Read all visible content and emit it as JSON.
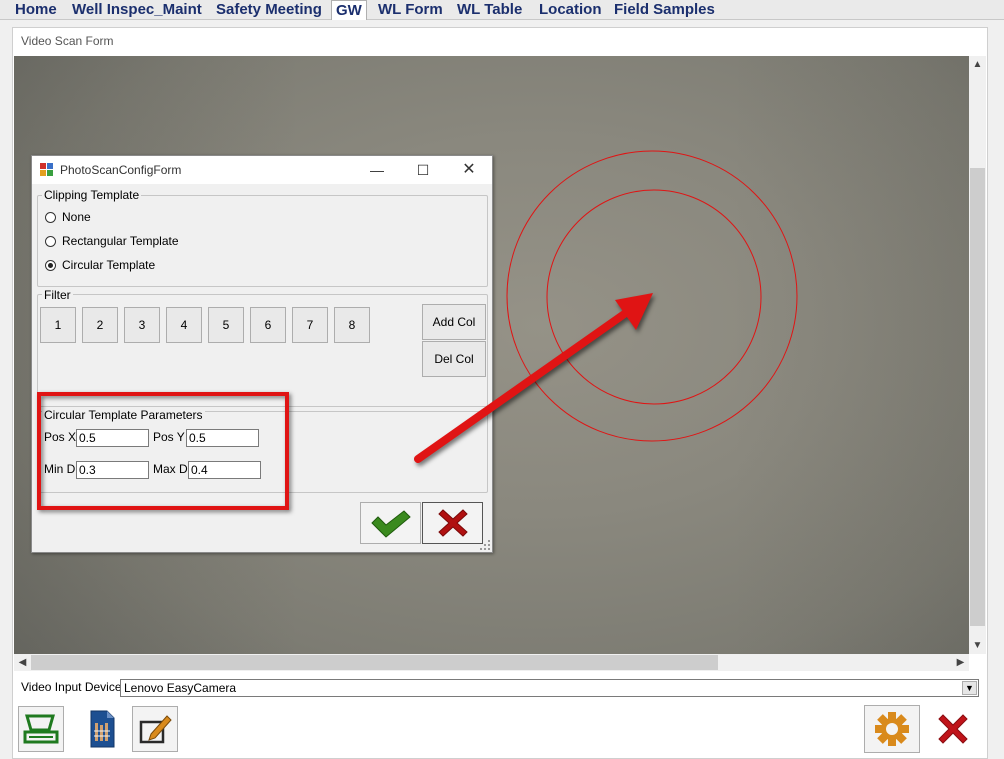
{
  "tabs": [
    {
      "label": "Home"
    },
    {
      "label": "Well Inspec_Maint"
    },
    {
      "label": "Safety Meeting"
    },
    {
      "label": "GW"
    },
    {
      "label": "WL Form"
    },
    {
      "label": "WL Table"
    },
    {
      "label": "Location"
    },
    {
      "label": "Field Samples"
    }
  ],
  "active_tab": "GW",
  "form": {
    "title": "Video Scan Form",
    "device_label": "Video Input Device:",
    "device_value": "Lenovo EasyCamera"
  },
  "dialog": {
    "title": "PhotoScanConfigForm",
    "clipping": {
      "legend": "Clipping Template",
      "options": [
        {
          "label": "None",
          "selected": false
        },
        {
          "label": "Rectangular Template",
          "selected": false
        },
        {
          "label": "Circular Template",
          "selected": true
        }
      ]
    },
    "filter": {
      "legend": "Filter",
      "buttons": [
        "1",
        "2",
        "3",
        "4",
        "5",
        "6",
        "7",
        "8"
      ],
      "add_col": "Add Col",
      "del_col": "Del Col"
    },
    "params": {
      "legend": "Circular Template Parameters",
      "pos_x_label": "Pos X",
      "pos_x_value": "0.5",
      "pos_y_label": "Pos Y",
      "pos_y_value": "0.5",
      "min_d_label": "Min D",
      "min_d_value": "0.3",
      "max_d_label": "Max D",
      "max_d_value": "0.4"
    }
  },
  "icons": {
    "scanner": "scanner-icon",
    "document": "document-icon",
    "edit": "edit-icon",
    "settings": "gear-icon",
    "cancel": "close-icon",
    "ok": "checkmark-icon"
  },
  "colors": {
    "annotation": "#e01414",
    "tab_text": "#1b2f6e",
    "ok_green": "#3a8a1e",
    "cancel_red": "#b01010",
    "gear_orange": "#d98a1c"
  }
}
